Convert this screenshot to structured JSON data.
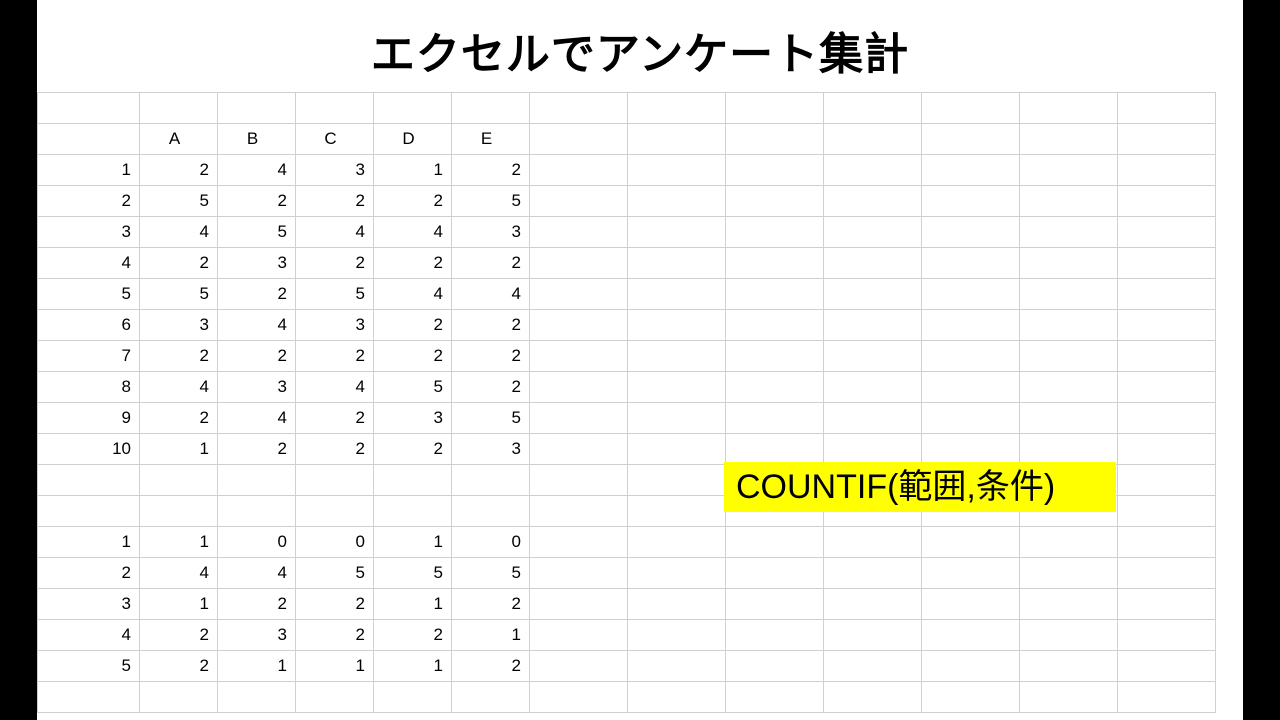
{
  "title": "エクセルでアンケート集計",
  "columns": [
    "A",
    "B",
    "C",
    "D",
    "E"
  ],
  "rows_top": [
    {
      "label": "1",
      "v": [
        2,
        4,
        3,
        1,
        2
      ]
    },
    {
      "label": "2",
      "v": [
        5,
        2,
        2,
        2,
        5
      ]
    },
    {
      "label": "3",
      "v": [
        4,
        5,
        4,
        4,
        3
      ]
    },
    {
      "label": "4",
      "v": [
        2,
        3,
        2,
        2,
        2
      ]
    },
    {
      "label": "5",
      "v": [
        5,
        2,
        5,
        4,
        4
      ]
    },
    {
      "label": "6",
      "v": [
        3,
        4,
        3,
        2,
        2
      ]
    },
    {
      "label": "7",
      "v": [
        2,
        2,
        2,
        2,
        2
      ]
    },
    {
      "label": "8",
      "v": [
        4,
        3,
        4,
        5,
        2
      ]
    },
    {
      "label": "9",
      "v": [
        2,
        4,
        2,
        3,
        5
      ]
    },
    {
      "label": "10",
      "v": [
        1,
        2,
        2,
        2,
        3
      ]
    }
  ],
  "rows_bottom": [
    {
      "label": "1",
      "v": [
        1,
        0,
        0,
        1,
        0
      ]
    },
    {
      "label": "2",
      "v": [
        4,
        4,
        5,
        5,
        5
      ]
    },
    {
      "label": "3",
      "v": [
        1,
        2,
        2,
        1,
        2
      ]
    },
    {
      "label": "4",
      "v": [
        2,
        3,
        2,
        2,
        1
      ]
    },
    {
      "label": "5",
      "v": [
        2,
        1,
        1,
        1,
        2
      ]
    }
  ],
  "highlight": "COUNTIF(範囲,条件)"
}
